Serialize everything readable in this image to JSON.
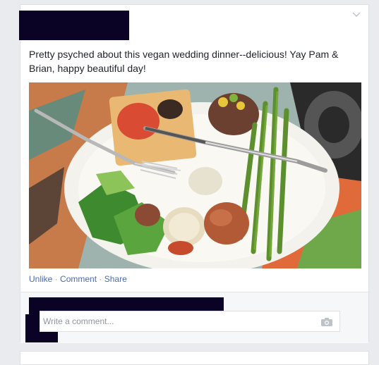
{
  "post": {
    "text": "Pretty psyched about this vegan wedding dinner--delicious! Yay Pam & Brian, happy beautiful day!",
    "photo_icon": "food-photo",
    "menu_icon": "chevron-down-icon"
  },
  "actions": {
    "unlike": "Unlike",
    "comment": "Comment",
    "share": "Share",
    "separator": "·"
  },
  "comment_box": {
    "placeholder": "Write a comment...",
    "icon": "camera-icon"
  },
  "colors": {
    "link": "#4b6aab",
    "redaction": "#0b0326",
    "background": "#e9ebee"
  }
}
